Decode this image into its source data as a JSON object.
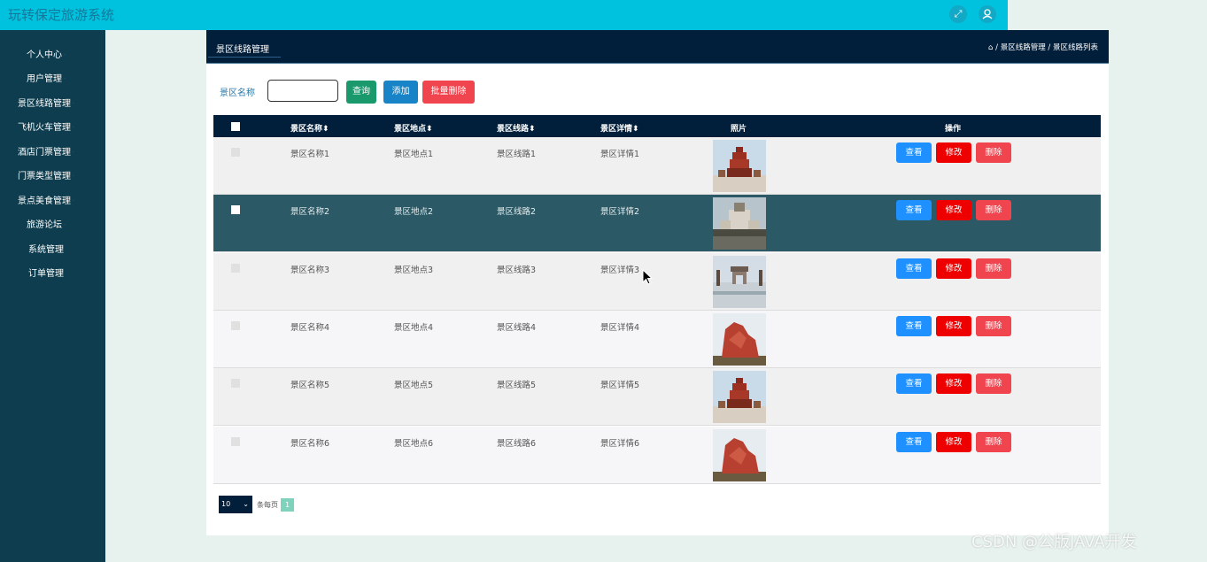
{
  "app": {
    "title": "玩转保定旅游系统"
  },
  "topbar": {
    "fullscreen_icon": "fullscreen-icon",
    "user_icon": "user-icon"
  },
  "sidebar": {
    "items": [
      {
        "label": "个人中心"
      },
      {
        "label": "用户管理"
      },
      {
        "label": "景区线路管理"
      },
      {
        "label": "飞机火车管理"
      },
      {
        "label": "酒店门票管理"
      },
      {
        "label": "门票类型管理"
      },
      {
        "label": "景点美食管理"
      },
      {
        "label": "旅游论坛"
      },
      {
        "label": "系统管理"
      },
      {
        "label": "订单管理"
      }
    ]
  },
  "panel": {
    "title": "景区线路管理",
    "breadcrumb": "/ 景区线路管理 / 景区线路列表"
  },
  "search": {
    "label": "景区名称",
    "value": "",
    "query_button": "查询",
    "add_button": "添加",
    "batch_delete_button": "批量删除"
  },
  "table": {
    "columns": [
      "景区名称",
      "景区地点",
      "景区线路",
      "景区详情",
      "照片",
      "操作"
    ],
    "rows": [
      {
        "name": "景区名称1",
        "location": "景区地点1",
        "route": "景区线路1",
        "detail": "景区详情1",
        "photo": "pagoda"
      },
      {
        "name": "景区名称2",
        "location": "景区地点2",
        "route": "景区线路2",
        "detail": "景区详情2",
        "photo": "castle"
      },
      {
        "name": "景区名称3",
        "location": "景区地点3",
        "route": "景区线路3",
        "detail": "景区详情3",
        "photo": "pavilion"
      },
      {
        "name": "景区名称4",
        "location": "景区地点4",
        "route": "景区线路4",
        "detail": "景区详情4",
        "photo": "rock"
      },
      {
        "name": "景区名称5",
        "location": "景区地点5",
        "route": "景区线路5",
        "detail": "景区详情5",
        "photo": "pagoda"
      },
      {
        "name": "景区名称6",
        "location": "景区地点6",
        "route": "景区线路6",
        "detail": "景区详情6",
        "photo": "rock"
      }
    ],
    "actions": {
      "view": "查看",
      "edit": "修改",
      "delete": "删除"
    }
  },
  "pagination": {
    "page_size": "10",
    "per_page_label": "条每页",
    "current_page": "1"
  },
  "watermark": "CSDN @公版JAVA开发",
  "colors": {
    "topbar": "#00c2df",
    "sidebar": "#0d3d4e",
    "header": "#011e3a",
    "view": "#1e90ff",
    "edit": "#ee0000",
    "delete": "#f0454f",
    "highlight_row": "#2b5966"
  }
}
